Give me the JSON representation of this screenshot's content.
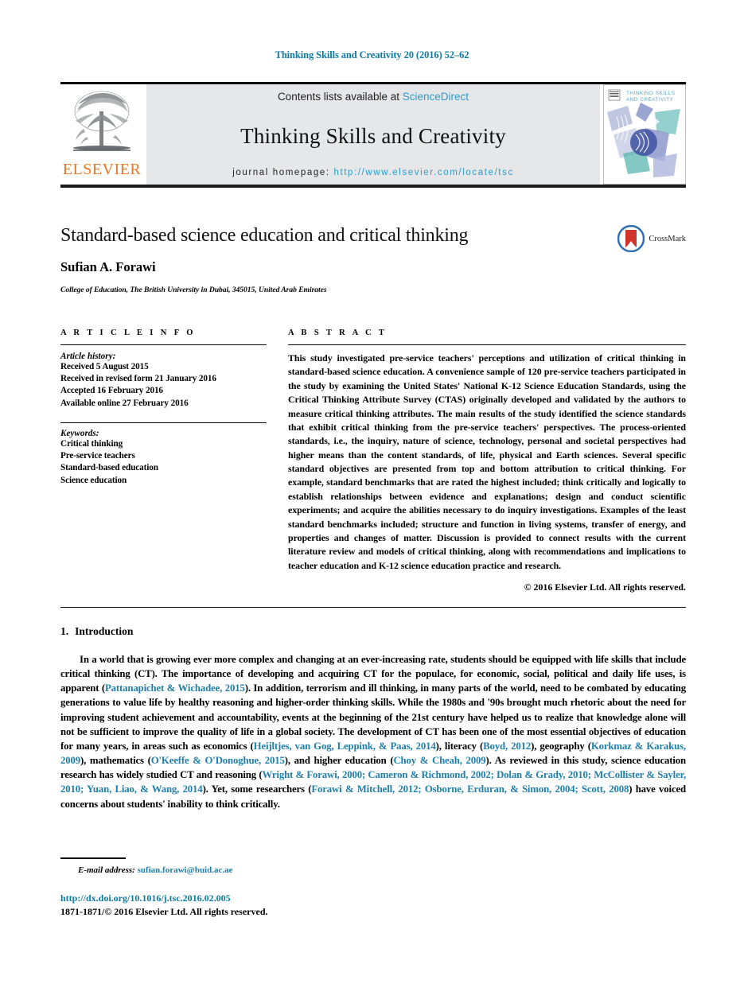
{
  "running_head": "Thinking Skills and Creativity 20 (2016) 52–62",
  "masthead": {
    "publisher_logo_name": "elsevier-tree-logo",
    "publisher_wordmark": "ELSEVIER",
    "contents_prefix": "Contents lists available at ",
    "contents_link": "ScienceDirect",
    "journal_title": "Thinking Skills and Creativity",
    "homepage_label": "journal homepage: ",
    "homepage_url": "http://www.elsevier.com/locate/tsc",
    "cover_title_line1": "THINKING SKILLS",
    "cover_title_line2": "AND CREATIVITY"
  },
  "article": {
    "title": "Standard-based science education and critical thinking",
    "author": "Sufian A. Forawi",
    "affiliation": "College of Education, The British University in Dubai, 345015, United Arab Emirates",
    "crossmark_label": "CrossMark"
  },
  "article_info": {
    "heading": "A R T I C L E   I N F O",
    "history_label": "Article history:",
    "history": [
      "Received 5 August 2015",
      "Received in revised form 21 January 2016",
      "Accepted 16 February 2016",
      "Available online 27 February 2016"
    ],
    "keywords_label": "Keywords:",
    "keywords": [
      "Critical thinking",
      "Pre-service teachers",
      "Standard-based education",
      "Science education"
    ]
  },
  "abstract": {
    "heading": "A B S T R A C T",
    "text": "This study investigated pre-service teachers' perceptions and utilization of critical thinking in standard-based science education. A convenience sample of 120 pre-service teachers participated in the study by examining the United States' National K-12 Science Education Standards, using the Critical Thinking Attribute Survey (CTAS) originally developed and validated by the authors to measure critical thinking attributes. The main results of the study identified the science standards that exhibit critical thinking from the pre-service teachers' perspectives. The process-oriented standards, i.e., the inquiry, nature of science, technology, personal and societal perspectives had higher means than the content standards, of life, physical and Earth sciences. Several specific standard objectives are presented from top and bottom attribution to critical thinking. For example, standard benchmarks that are rated the highest included; think critically and logically to establish relationships between evidence and explanations; design and conduct scientific experiments; and acquire the abilities necessary to do inquiry investigations. Examples of the least standard benchmarks included; structure and function in living systems, transfer of energy, and properties and changes of matter. Discussion is provided to connect results with the current literature review and models of critical thinking, along with recommendations and implications to teacher education and K-12 science education practice and research.",
    "copyright": "© 2016 Elsevier Ltd. All rights reserved."
  },
  "introduction": {
    "number": "1.",
    "heading": "Introduction",
    "paragraph_parts": [
      {
        "t": "In a world that is growing ever more complex and changing at an ever-increasing rate, students should be equipped with life skills that include critical thinking (CT). The importance of developing and acquiring CT for the populace, for economic, social, political and daily life uses, is apparent (",
        "c": false
      },
      {
        "t": "Pattanapichet & Wichadee, 2015",
        "c": true
      },
      {
        "t": "). In addition, terrorism and ill thinking, in many parts of the world, need to be combated by educating generations to value life by healthy reasoning and higher-order thinking skills. While the 1980s and '90s brought much rhetoric about the need for improving student achievement and accountability, events at the beginning of the 21st century have helped us to realize that knowledge alone will not be sufficient to improve the quality of life in a global society. The development of CT has been one of the most essential objectives of education for many years, in areas such as economics (",
        "c": false
      },
      {
        "t": "Heijltjes, van Gog, Leppink, & Paas, 2014",
        "c": true
      },
      {
        "t": "), literacy (",
        "c": false
      },
      {
        "t": "Boyd, 2012",
        "c": true
      },
      {
        "t": "), geography (",
        "c": false
      },
      {
        "t": "Korkmaz & Karakus, 2009",
        "c": true
      },
      {
        "t": "), mathematics (",
        "c": false
      },
      {
        "t": "O'Keeffe & O'Donoghue, 2015",
        "c": true
      },
      {
        "t": "), and higher education (",
        "c": false
      },
      {
        "t": "Choy & Cheah, 2009",
        "c": true
      },
      {
        "t": "). As reviewed in this study, science education research has widely studied CT and reasoning (",
        "c": false
      },
      {
        "t": "Wright & Forawi, 2000; Cameron & Richmond, 2002; Dolan & Grady, 2010; McCollister & Sayler, 2010; Yuan, Liao, & Wang, 2014",
        "c": true
      },
      {
        "t": "). Yet, some researchers (",
        "c": false
      },
      {
        "t": "Forawi & Mitchell, 2012; Osborne, Erduran, & Simon, 2004; Scott, 2008",
        "c": true
      },
      {
        "t": ") have voiced concerns about students' inability to think critically.",
        "c": false
      }
    ]
  },
  "footnote": {
    "email_label": "E-mail address:",
    "email": "sufian.forawi@buid.ac.ae"
  },
  "colophon": {
    "doi": "http://dx.doi.org/10.1016/j.tsc.2016.02.005",
    "issn_line": "1871-1871/© 2016 Elsevier Ltd. All rights reserved."
  },
  "colors": {
    "link_blue": "#2e9bc9",
    "cite_blue": "#1f7fab",
    "running_head_blue": "#0b7ba5",
    "elsevier_orange": "#e87722",
    "masthead_gray": "#e6e7e8"
  }
}
